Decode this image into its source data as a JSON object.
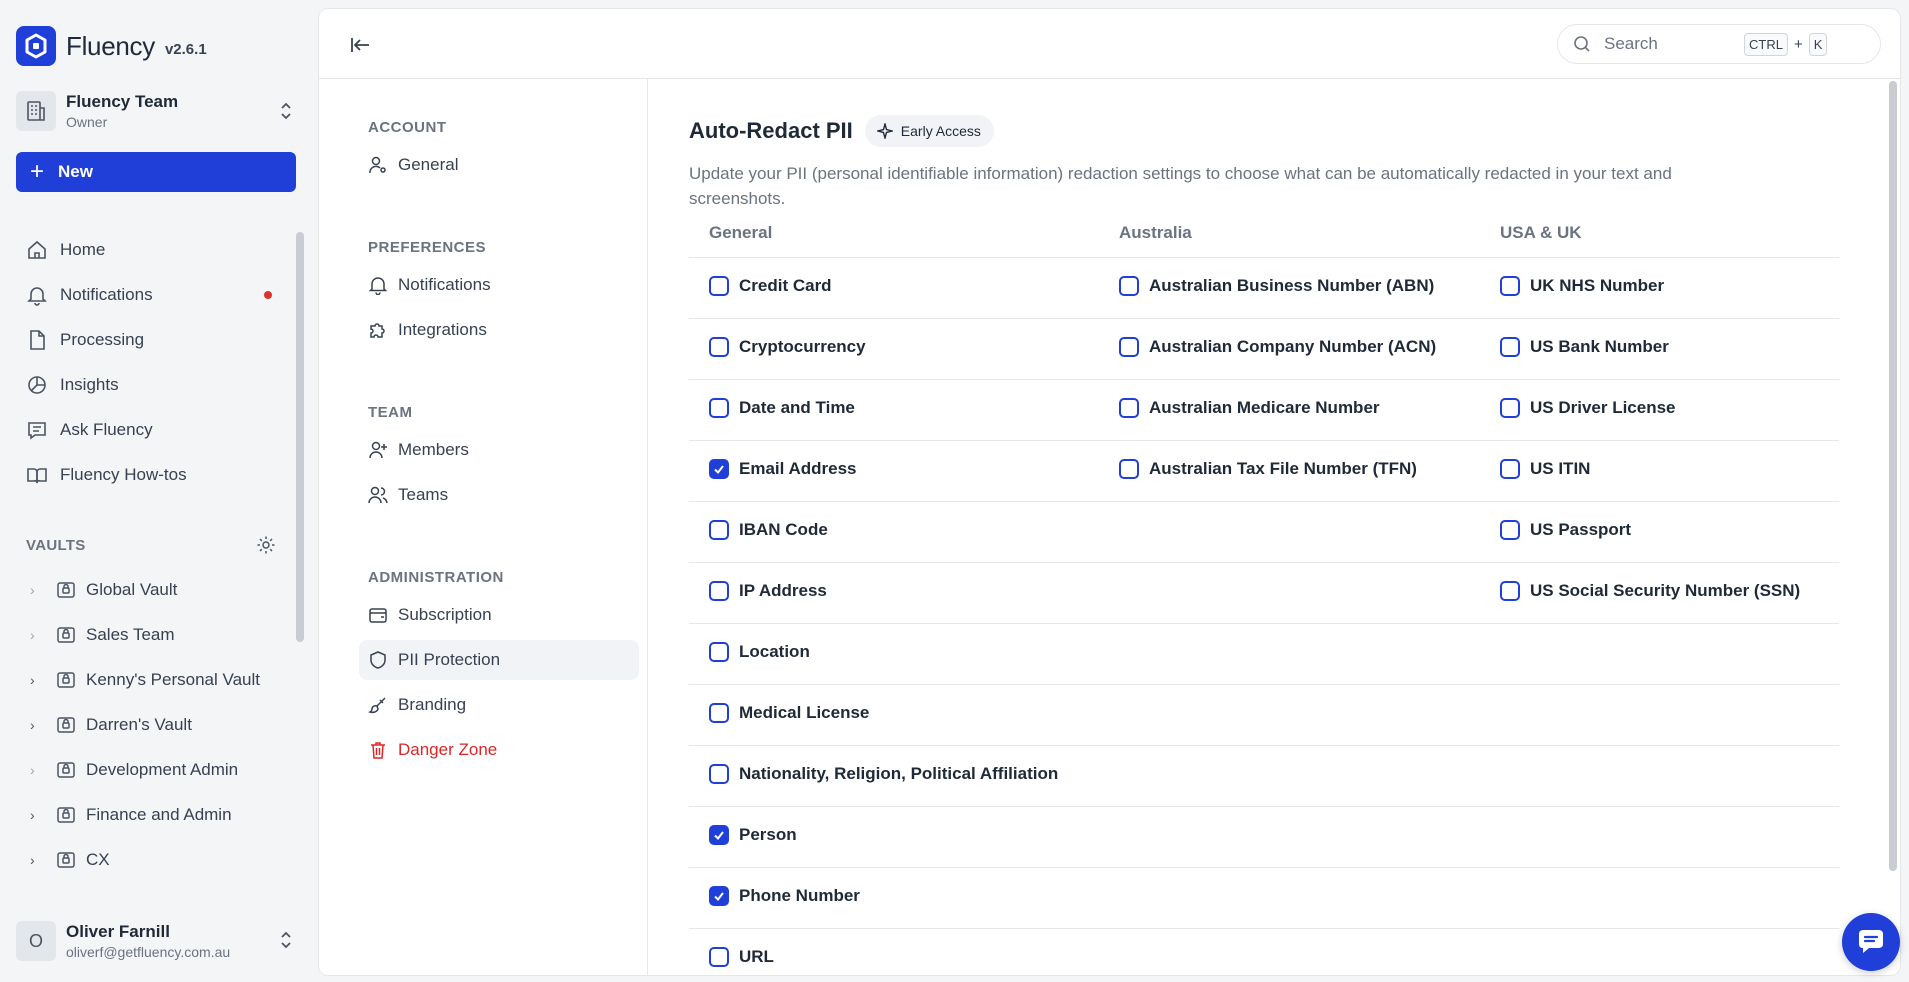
{
  "brand": {
    "name": "Fluency",
    "version": "v2.6.1"
  },
  "team": {
    "name": "Fluency Team",
    "role": "Owner"
  },
  "new_button": {
    "label": "New"
  },
  "nav": [
    {
      "label": "Home",
      "icon": "home-icon"
    },
    {
      "label": "Notifications",
      "icon": "bell-icon"
    },
    {
      "label": "Processing",
      "icon": "file-icon"
    },
    {
      "label": "Insights",
      "icon": "pie-chart-icon"
    },
    {
      "label": "Ask Fluency",
      "icon": "message-icon"
    },
    {
      "label": "Fluency How-tos",
      "icon": "book-icon"
    }
  ],
  "vaults": {
    "label": "VAULTS",
    "items": [
      {
        "label": "Global Vault"
      },
      {
        "label": "Sales Team"
      },
      {
        "label": "Kenny's Personal Vault"
      },
      {
        "label": "Darren's Vault"
      },
      {
        "label": "Development Admin"
      },
      {
        "label": "Finance and Admin"
      },
      {
        "label": "CX"
      }
    ]
  },
  "user": {
    "initial": "O",
    "name": "Oliver Farnill",
    "email": "oliverf@getfluency.com.au"
  },
  "search": {
    "placeholder": "Search",
    "key1": "CTRL",
    "plus": "+",
    "key2": "K"
  },
  "settings_nav": {
    "account_label": "ACCOUNT",
    "general": "General",
    "preferences_label": "PREFERENCES",
    "notifications": "Notifications",
    "integrations": "Integrations",
    "team_label": "TEAM",
    "members": "Members",
    "teams": "Teams",
    "admin_label": "ADMINISTRATION",
    "subscription": "Subscription",
    "pii": "PII Protection",
    "branding": "Branding",
    "danger": "Danger Zone"
  },
  "content": {
    "title": "Auto-Redact PII",
    "badge": "Early Access",
    "description": "Update your PII (personal identifiable information) redaction settings to choose what can be automatically redacted in your text and screenshots.",
    "columns": [
      "General",
      "Australia",
      "USA & UK"
    ],
    "general": [
      {
        "label": "Credit Card",
        "checked": false
      },
      {
        "label": "Cryptocurrency",
        "checked": false
      },
      {
        "label": "Date and Time",
        "checked": false
      },
      {
        "label": "Email Address",
        "checked": true
      },
      {
        "label": "IBAN Code",
        "checked": false
      },
      {
        "label": "IP Address",
        "checked": false
      },
      {
        "label": "Location",
        "checked": false
      },
      {
        "label": "Medical License",
        "checked": false
      },
      {
        "label": "Nationality, Religion, Political Affiliation",
        "checked": false
      },
      {
        "label": "Person",
        "checked": true
      },
      {
        "label": "Phone Number",
        "checked": true
      },
      {
        "label": "URL",
        "checked": false
      }
    ],
    "australia": [
      {
        "label": "Australian Business Number (ABN)",
        "checked": false
      },
      {
        "label": "Australian Company Number (ACN)",
        "checked": false
      },
      {
        "label": "Australian Medicare Number",
        "checked": false
      },
      {
        "label": "Australian Tax File Number (TFN)",
        "checked": false
      }
    ],
    "usa_uk": [
      {
        "label": "UK NHS Number",
        "checked": false
      },
      {
        "label": "US Bank Number",
        "checked": false
      },
      {
        "label": "US Driver License",
        "checked": false
      },
      {
        "label": "US ITIN",
        "checked": false
      },
      {
        "label": "US Passport",
        "checked": false
      },
      {
        "label": "US Social Security Number (SSN)",
        "checked": false
      }
    ]
  },
  "colors": {
    "accent": "#1f3fd8",
    "danger": "#dc2626",
    "notification_dot": "#d9342b"
  }
}
